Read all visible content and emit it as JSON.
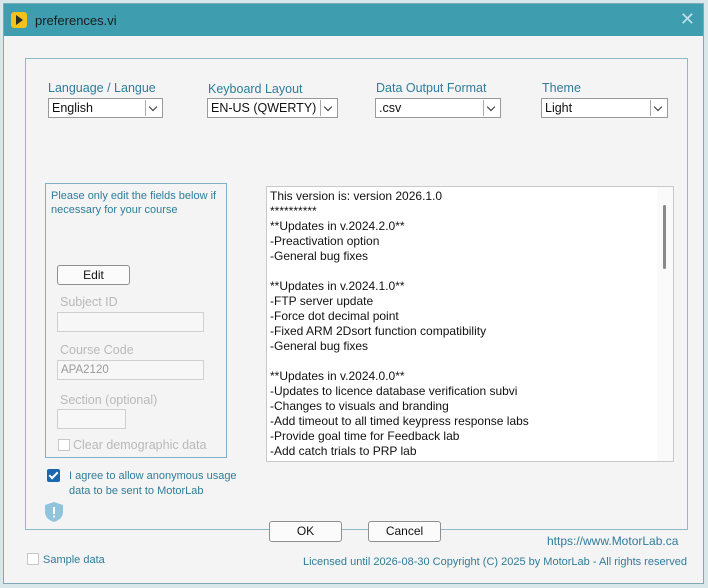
{
  "window": {
    "title": "preferences.vi",
    "close_glyph": "✕"
  },
  "settings": {
    "language": {
      "label": "Language / Langue",
      "value": "English"
    },
    "keyboard": {
      "label": "Keyboard Layout",
      "value": "EN-US (QWERTY)"
    },
    "output": {
      "label": "Data Output Format",
      "value": ".csv"
    },
    "theme": {
      "label": "Theme",
      "value": "Light"
    }
  },
  "course_box": {
    "note": "Please only edit the fields below if necessary for your course",
    "edit_label": "Edit",
    "subject_id_label": "Subject ID",
    "subject_id_value": "",
    "course_code_label": "Course Code",
    "course_code_value": "APA2120",
    "section_label": "Section (optional)",
    "section_value": "",
    "clear_label": "Clear demographic data"
  },
  "consent": {
    "label": "I agree to allow anonymous usage data to be sent to MotorLab",
    "checked": true
  },
  "release_notes": "This version is: version 2026.1.0\n**********\n**Updates in v.2024.2.0**\n-Preactivation option\n-General bug fixes\n\n**Updates in v.2024.1.0**\n-FTP server update\n-Force dot decimal point\n-Fixed ARM 2Dsort function compatibility\n-General bug fixes\n\n**Updates in v.2024.0.0**\n-Updates to licence database verification subvi\n-Changes to visuals and branding\n-Add timeout to all timed keypress response labs\n-Provide goal time for Feedback lab\n-Add catch trials to PRP lab",
  "buttons": {
    "ok": "OK",
    "cancel": "Cancel"
  },
  "footer": {
    "url": "https://www.MotorLab.ca",
    "sample_data_label": "Sample data",
    "license": "Licensed until 2026-08-30 Copyright (C) 2025 by MotorLab - All rights reserved"
  },
  "colors": {
    "titlebar": "#3e9dae",
    "accent_text": "#2f7d9a",
    "checkbox": "#1a67b0"
  },
  "icons": {
    "app": "labview-run-icon",
    "close": "close-icon",
    "shield": "shield-icon"
  }
}
